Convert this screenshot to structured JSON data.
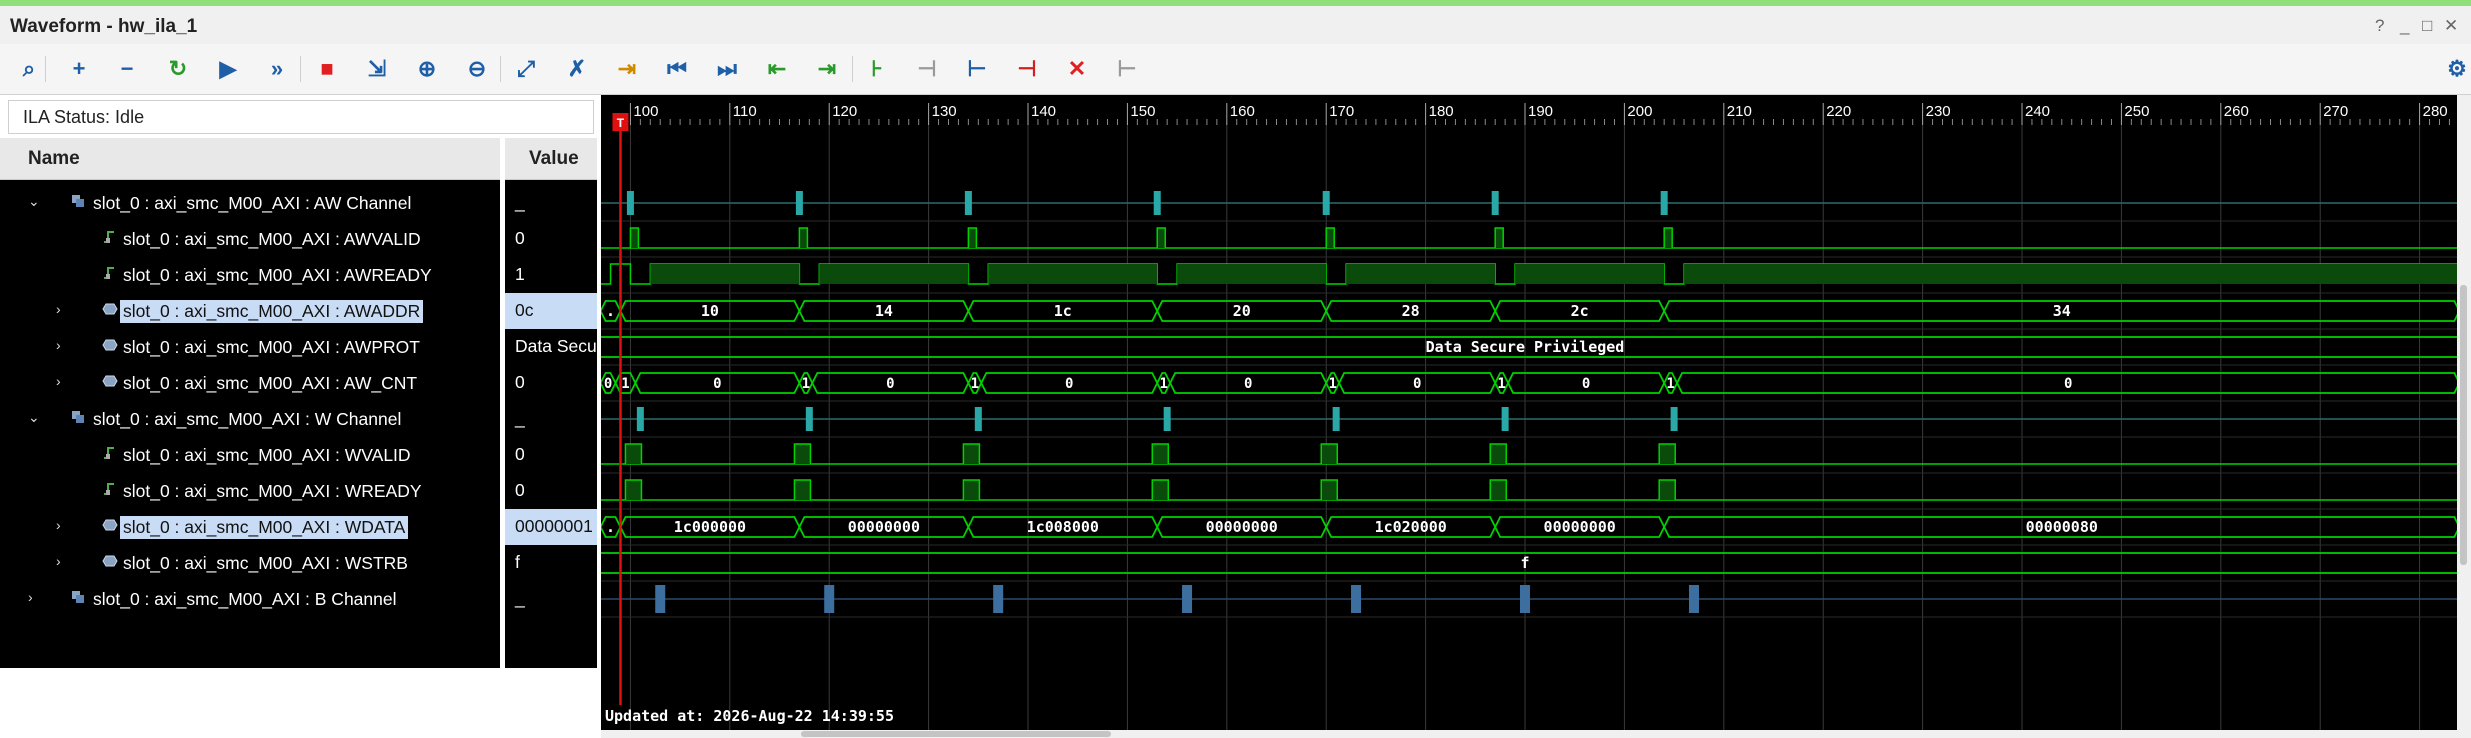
{
  "window": {
    "title": "Waveform - hw_ila_1",
    "controls": [
      "?",
      "_",
      "□",
      "✕"
    ]
  },
  "toolbar": [
    {
      "name": "search-button",
      "glyph": "⌕",
      "color": "#1f5fa8"
    },
    {
      "name": "add-button",
      "glyph": "+",
      "color": "#1f5fa8"
    },
    {
      "name": "remove-button",
      "glyph": "−",
      "color": "#1f5fa8"
    },
    {
      "name": "auto-retrigger-button",
      "glyph": "↻",
      "color": "#2a9a2a"
    },
    {
      "name": "run-trigger-button",
      "glyph": "▶",
      "color": "#1f5fa8"
    },
    {
      "name": "run-immediate-button",
      "glyph": "»",
      "color": "#1f5fa8"
    },
    {
      "name": "stop-button",
      "glyph": "■",
      "color": "#e02020"
    },
    {
      "name": "export-button",
      "glyph": "⇲",
      "color": "#1f5fa8"
    },
    {
      "name": "zoom-in-button",
      "glyph": "⊕",
      "color": "#1f5fa8"
    },
    {
      "name": "zoom-out-button",
      "glyph": "⊖",
      "color": "#1f5fa8"
    },
    {
      "name": "zoom-fit-button",
      "glyph": "⤢",
      "color": "#1f5fa8"
    },
    {
      "name": "cursor-button",
      "glyph": "✗",
      "color": "#1f5fa8"
    },
    {
      "name": "marker-button",
      "glyph": "⇥",
      "color": "#d08a00"
    },
    {
      "name": "go-to-start-button",
      "glyph": "⏮",
      "color": "#1f5fa8"
    },
    {
      "name": "go-to-end-button",
      "glyph": "⏭",
      "color": "#1f5fa8"
    },
    {
      "name": "prev-transition-button",
      "glyph": "⇤",
      "color": "#2a9a2a"
    },
    {
      "name": "next-transition-button",
      "glyph": "⇥",
      "color": "#2a9a2a"
    },
    {
      "name": "add-marker-button",
      "glyph": "⊦",
      "color": "#2a9a2a"
    },
    {
      "name": "prev-marker-button",
      "glyph": "⊣",
      "color": "#9a9a9a"
    },
    {
      "name": "next-marker-button",
      "glyph": "⊢",
      "color": "#1f5fa8"
    },
    {
      "name": "swap-cursors-button",
      "glyph": "⊣",
      "color": "#d02020"
    },
    {
      "name": "delete-markers-button",
      "glyph": "✕",
      "color": "#e02020"
    },
    {
      "name": "snap-button",
      "glyph": "⊢",
      "color": "#9a9a9a"
    },
    {
      "name": "settings-button",
      "glyph": "⚙",
      "color": "#1f5fa8"
    }
  ],
  "status": {
    "label": "ILA Status:",
    "value": "Idle",
    "text": "ILA Status:  Idle"
  },
  "columns": {
    "name": "Name",
    "value": "Value"
  },
  "signals": [
    {
      "label": "slot_0 : axi_smc_M00_AXI : AW Channel",
      "value": "_",
      "indent": 0,
      "expand": "open",
      "icon": "group",
      "selected": false
    },
    {
      "label": "slot_0 : axi_smc_M00_AXI : AWVALID",
      "value": "0",
      "indent": 1,
      "expand": "none",
      "icon": "bit",
      "selected": false
    },
    {
      "label": "slot_0 : axi_smc_M00_AXI : AWREADY",
      "value": "1",
      "indent": 1,
      "expand": "none",
      "icon": "bit",
      "selected": false
    },
    {
      "label": "slot_0 : axi_smc_M00_AXI : AWADDR",
      "value": "0c",
      "indent": 1,
      "expand": "closed",
      "icon": "bus",
      "selected": true
    },
    {
      "label": "slot_0 : axi_smc_M00_AXI : AWPROT",
      "value": "Data Secure Privileged",
      "indent": 1,
      "expand": "closed",
      "icon": "bus",
      "selected": false
    },
    {
      "label": "slot_0 : axi_smc_M00_AXI : AW_CNT",
      "value": "0",
      "indent": 1,
      "expand": "closed",
      "icon": "bus",
      "selected": false
    },
    {
      "label": "slot_0 : axi_smc_M00_AXI : W Channel",
      "value": "_",
      "indent": 0,
      "expand": "open",
      "icon": "group",
      "selected": false
    },
    {
      "label": "slot_0 : axi_smc_M00_AXI : WVALID",
      "value": "0",
      "indent": 1,
      "expand": "none",
      "icon": "bit",
      "selected": false
    },
    {
      "label": "slot_0 : axi_smc_M00_AXI : WREADY",
      "value": "0",
      "indent": 1,
      "expand": "none",
      "icon": "bit",
      "selected": false
    },
    {
      "label": "slot_0 : axi_smc_M00_AXI : WDATA",
      "value": "00000001",
      "indent": 1,
      "expand": "closed",
      "icon": "bus",
      "selected": true
    },
    {
      "label": "slot_0 : axi_smc_M00_AXI : WSTRB",
      "value": "f",
      "indent": 1,
      "expand": "closed",
      "icon": "bus",
      "selected": false
    },
    {
      "label": "slot_0 : axi_smc_M00_AXI : B Channel",
      "value": "_",
      "indent": 0,
      "expand": "closed",
      "icon": "group",
      "selected": false
    }
  ],
  "timeline": {
    "ticks": [
      "100",
      "110",
      "120",
      "130",
      "140",
      "150",
      "160",
      "170",
      "180",
      "190",
      "200",
      "210",
      "220",
      "230",
      "240",
      "250",
      "260",
      "270",
      "280"
    ],
    "cursor_sample": 99,
    "cursor_label": "T",
    "updated": "Updated at: 2026-Aug-22 14:39:55"
  },
  "waveforms": {
    "pulse_groups": {
      "aw": [
        100,
        117,
        134,
        153,
        170,
        187,
        204
      ],
      "w": [
        101,
        118,
        135,
        154,
        171,
        188,
        205
      ],
      "b": [
        103,
        120,
        137,
        156,
        173,
        190,
        207
      ]
    },
    "awready_low": [
      [
        100,
        101
      ],
      [
        117,
        118
      ],
      [
        134,
        135
      ],
      [
        153,
        154
      ],
      [
        170,
        171
      ],
      [
        187,
        188
      ],
      [
        204,
        205
      ]
    ],
    "awaddr": [
      {
        "s": 97,
        "e": 99,
        "v": "."
      },
      {
        "s": 99,
        "e": 117,
        "v": "10"
      },
      {
        "s": 117,
        "e": 134,
        "v": "14"
      },
      {
        "s": 134,
        "e": 153,
        "v": "1c"
      },
      {
        "s": 153,
        "e": 170,
        "v": "20"
      },
      {
        "s": 170,
        "e": 187,
        "v": "28"
      },
      {
        "s": 187,
        "e": 204,
        "v": "2c"
      },
      {
        "s": 204,
        "e": 284,
        "v": "34"
      }
    ],
    "awprot": "Data Secure Privileged",
    "aw_cnt": [
      {
        "s": 97,
        "e": 98.5,
        "v": "0"
      },
      {
        "s": 98.5,
        "e": 100.5,
        "v": "1"
      },
      {
        "s": 100.5,
        "e": 117,
        "v": "0"
      },
      {
        "s": 117,
        "e": 118.3,
        "v": "1"
      },
      {
        "s": 118.3,
        "e": 134,
        "v": "0"
      },
      {
        "s": 134,
        "e": 135.3,
        "v": "1"
      },
      {
        "s": 135.3,
        "e": 153,
        "v": "0"
      },
      {
        "s": 153,
        "e": 154.3,
        "v": "1"
      },
      {
        "s": 154.3,
        "e": 170,
        "v": "0"
      },
      {
        "s": 170,
        "e": 171.3,
        "v": "1"
      },
      {
        "s": 171.3,
        "e": 187,
        "v": "0"
      },
      {
        "s": 187,
        "e": 188.3,
        "v": "1"
      },
      {
        "s": 188.3,
        "e": 204,
        "v": "0"
      },
      {
        "s": 204,
        "e": 205.3,
        "v": "1"
      },
      {
        "s": 205.3,
        "e": 284,
        "v": "0"
      }
    ],
    "wdata": [
      {
        "s": 97,
        "e": 99,
        "v": "."
      },
      {
        "s": 99,
        "e": 117,
        "v": "1c000000"
      },
      {
        "s": 117,
        "e": 134,
        "v": "00000000"
      },
      {
        "s": 134,
        "e": 153,
        "v": "1c008000"
      },
      {
        "s": 153,
        "e": 170,
        "v": "00000000"
      },
      {
        "s": 170,
        "e": 187,
        "v": "1c020000"
      },
      {
        "s": 187,
        "e": 204,
        "v": "00000000"
      },
      {
        "s": 204,
        "e": 284,
        "v": "00000080"
      }
    ],
    "wstrb": "f"
  },
  "colors": {
    "signal_green": "#00d200",
    "fill_green": "#0a4a0a",
    "group_teal": "#2aa8a8",
    "bchan_blue": "#3c6fa0",
    "grid": "#3a3a3a",
    "cursor": "#e01010",
    "selected_bg": "#c9dcf5"
  }
}
